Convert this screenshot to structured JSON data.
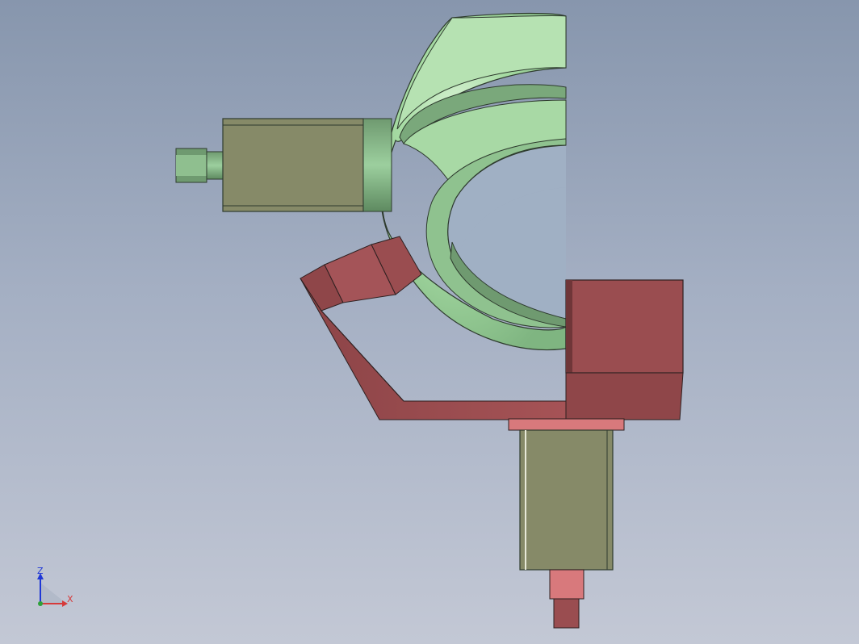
{
  "viewport": {
    "background_top": "#8796ad",
    "background_bottom": "#c3c8d5"
  },
  "model": {
    "components": [
      "green-arc-yoke",
      "left-motor",
      "bottom-motor",
      "red-bracket",
      "red-motor-mount-block",
      "red-angled-coupler"
    ],
    "colors": {
      "green_part": "#9fd49f",
      "motor_body": "#868a68",
      "motor_shaft": "#6f9a70",
      "red_part": "#9a4d50",
      "red_light": "#d8797c"
    }
  },
  "triad": {
    "z_label": "Z",
    "x_label": "X",
    "z_color": "#1f37d6",
    "x_color": "#d63a3a",
    "y_color": "#2ea13a"
  }
}
